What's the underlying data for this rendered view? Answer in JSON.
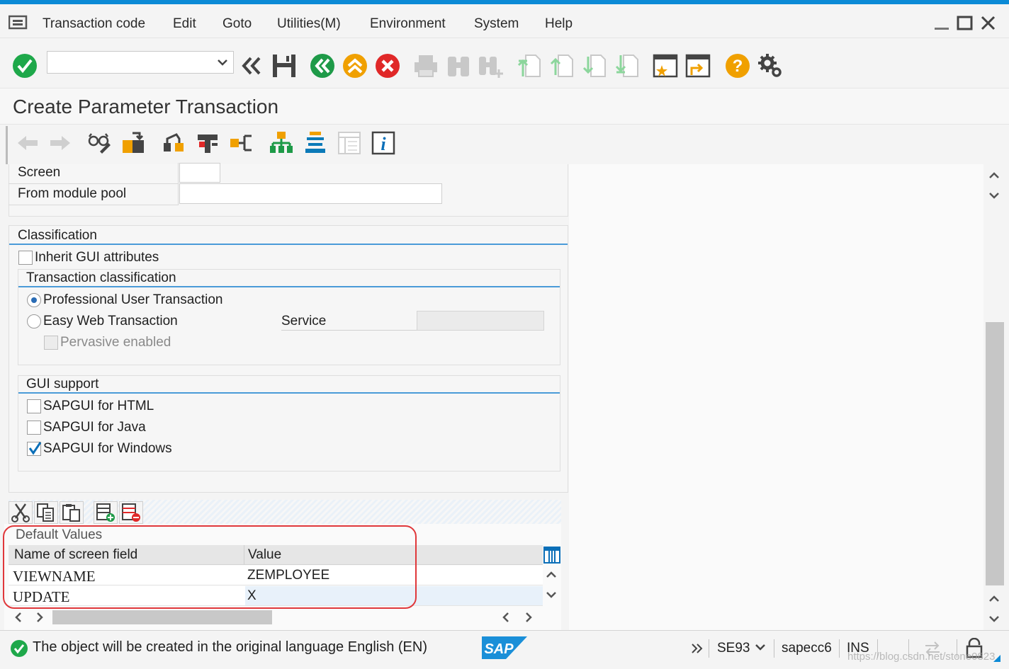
{
  "menu": {
    "items": [
      "Transaction code",
      "Edit",
      "Goto",
      "Utilities(M)",
      "Environment",
      "System",
      "Help"
    ]
  },
  "toolbar": {
    "command_value": "",
    "icons": [
      "enter-icon",
      "back-icon",
      "save-icon",
      "exit-icon",
      "cancel-icon",
      "print-icon",
      "find-icon",
      "find-next-icon",
      "first-page-icon",
      "previous-page-icon",
      "next-page-icon",
      "last-page-icon",
      "new-session-icon",
      "shortcut-icon",
      "help-icon",
      "settings-icon"
    ]
  },
  "page": {
    "title": "Create Parameter Transaction"
  },
  "form": {
    "screen_label": "Screen",
    "screen_value": "",
    "module_pool_label": "From module pool",
    "module_pool_value": "",
    "classification": {
      "title": "Classification",
      "inherit_gui_label": "Inherit GUI attributes",
      "inherit_gui_checked": false,
      "transaction_classification": {
        "title": "Transaction classification",
        "professional_label": "Professional User Transaction",
        "professional_selected": true,
        "easy_web_label": "Easy Web Transaction",
        "easy_web_selected": false,
        "service_label": "Service",
        "service_value": "",
        "pervasive_label": "Pervasive enabled",
        "pervasive_checked": false
      },
      "gui_support": {
        "title": "GUI support",
        "html_label": "SAPGUI for HTML",
        "html_checked": false,
        "java_label": "SAPGUI for Java",
        "java_checked": false,
        "windows_label": "SAPGUI for Windows",
        "windows_checked": true
      }
    }
  },
  "default_values": {
    "title": "Default Values",
    "columns": [
      "Name of screen field",
      "Value"
    ],
    "rows": [
      {
        "field": "VIEWNAME",
        "value": "ZEMPLOYEE"
      },
      {
        "field": "UPDATE",
        "value": "X"
      }
    ]
  },
  "status": {
    "message": "The object will be created in the original language English (EN)",
    "transaction": "SE93",
    "system": "sapecc6",
    "mode": "INS",
    "logo": "SAP",
    "watermark": "https://blog.csdn.net/stone0823"
  },
  "colors": {
    "accent": "#0b8ad6",
    "ok_green": "#1ea84a",
    "warn_orange": "#f0a000",
    "error_red": "#e02828",
    "highlight": "#e0383b"
  }
}
